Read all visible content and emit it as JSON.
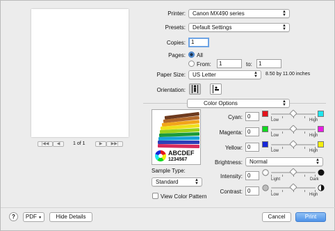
{
  "left": {
    "page_counter": "1 of 1",
    "nav_first": "|◀◀",
    "nav_prev": "◀",
    "nav_next": "▶",
    "nav_last": "▶▶|"
  },
  "form": {
    "printer_label": "Printer:",
    "printer_value": "Canon MX490 series",
    "presets_label": "Presets:",
    "presets_value": "Default Settings",
    "copies_label": "Copies:",
    "copies_value": "1",
    "pages_label": "Pages:",
    "pages_all": "All",
    "pages_from": "From:",
    "pages_from_value": "1",
    "pages_to": "to:",
    "pages_to_value": "1",
    "paper_size_label": "Paper Size:",
    "paper_size_value": "US Letter",
    "paper_size_dims": "8.50 by 11.00 inches",
    "orientation_label": "Orientation:",
    "section_value": "Color Options"
  },
  "color_options": {
    "sample_text_1": "ABCDEF",
    "sample_text_2": "1234567",
    "sample_type_label": "Sample Type:",
    "sample_type_value": "Standard",
    "view_color_pattern": "View Color Pattern",
    "cyan_label": "Cyan:",
    "cyan_value": "0",
    "magenta_label": "Magenta:",
    "magenta_value": "0",
    "yellow_label": "Yellow:",
    "yellow_value": "0",
    "brightness_label": "Brightness:",
    "brightness_value": "Normal",
    "intensity_label": "Intensity:",
    "intensity_value": "0",
    "contrast_label": "Contrast:",
    "contrast_value": "0",
    "low": "Low",
    "high": "High",
    "light": "Light",
    "dark": "Dark",
    "colors": {
      "cyan": "#1ee6ee",
      "magenta": "#e81ce3",
      "yellow": "#f4ee0c",
      "red": "#e5141d",
      "green": "#10d91f",
      "blue": "#1727d8"
    }
  },
  "footer": {
    "help": "?",
    "pdf": "PDF",
    "hide_details": "Hide Details",
    "cancel": "Cancel",
    "print": "Print"
  }
}
